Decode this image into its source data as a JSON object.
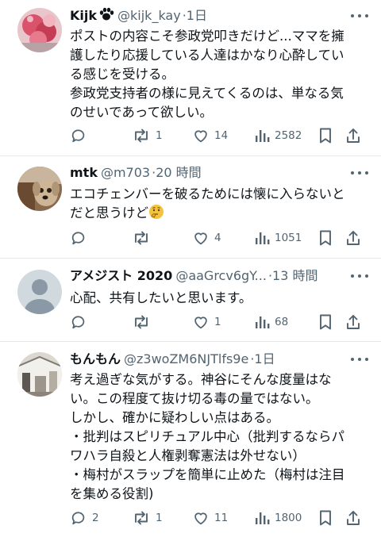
{
  "posts": [
    {
      "name": "Kijk",
      "name_badge": "paw-icon",
      "handle": "@kijk_kay",
      "time": "1日",
      "lines": [
        "ポストの内容こそ参政党叩きだけど...ママを擁",
        "護したり応援している人達はかなり心酔してい",
        "る感じを受ける。",
        "参政党支持者の様に見えてくるのは、単なる気",
        "のせいであって欲しい。"
      ],
      "replies": "",
      "reposts": "1",
      "likes": "14",
      "views": "2582"
    },
    {
      "name": "mtk",
      "handle": "@m703",
      "time": "20 時間",
      "lines": [
        "エコチェンバーを破るためには懐に入らないと",
        "だと思うけど"
      ],
      "trailing_emoji": "thinking-face-emoji",
      "replies": "",
      "reposts": "",
      "likes": "4",
      "views": "1051"
    },
    {
      "name": "アメジスト 2020",
      "handle": "@aaGrcv6gY...",
      "time": "13 時間",
      "lines": [
        "心配、共有したいと思います。"
      ],
      "replies": "",
      "reposts": "",
      "likes": "1",
      "views": "68"
    },
    {
      "name": "もんもん",
      "handle": "@z3woZM6NJTlfs9e",
      "time": "1日",
      "lines": [
        "考え過ぎな気がする。神谷にそんな度量はな",
        "い。この程度て抜け切る毒の量ではない。",
        "しかし、確かに疑わしい点はある。",
        "・批判はスピリチュアル中心（批判するならパ",
        "ワハラ自殺と人権剥奪憲法は外せない）",
        "・梅村がスラップを簡単に止めた（梅村は注目",
        "を集める役割)"
      ],
      "replies": "2",
      "reposts": "1",
      "likes": "11",
      "views": "1800"
    }
  ],
  "icons": {
    "reply": "reply-icon",
    "repost": "repost-icon",
    "like": "heart-icon",
    "views": "views-icon",
    "bookmark": "bookmark-icon",
    "share": "share-icon",
    "more": "more-icon"
  },
  "colors": {
    "text": "#0f1419",
    "secondary": "#536471",
    "divider": "#e6e9ec"
  }
}
